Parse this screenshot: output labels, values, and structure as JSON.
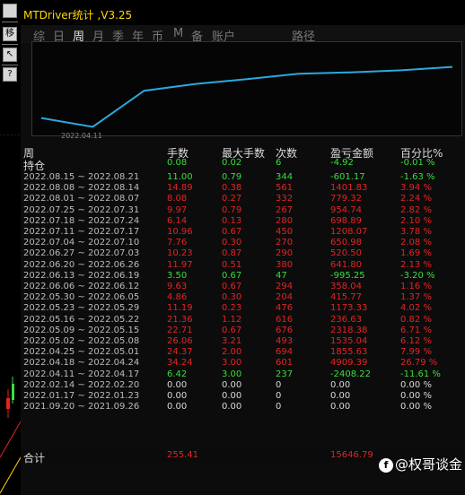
{
  "window": {
    "title": "MTDriver统计 ,V3.25"
  },
  "toolbar": {
    "buttons": [
      {
        "label": "",
        "icon": "arrow-icon"
      },
      {
        "label": "移",
        "icon": "move-icon"
      },
      {
        "label": "↖",
        "icon": "cursor-icon"
      },
      {
        "label": "",
        "icon": "line-icon"
      },
      {
        "label": "?",
        "icon": "help-icon"
      }
    ]
  },
  "tabs": [
    {
      "label": "综"
    },
    {
      "label": "日"
    },
    {
      "label": "周"
    },
    {
      "label": "月"
    },
    {
      "label": "季"
    },
    {
      "label": "年"
    },
    {
      "label": "币"
    },
    {
      "label": "M"
    },
    {
      "label": "备"
    },
    {
      "label": "账户"
    },
    {
      "label": "路径"
    }
  ],
  "equity_chart": {
    "date_label": "2022.04.11",
    "line_color": "#2aa9e0",
    "points": [
      [
        0,
        0.15
      ],
      [
        1,
        0.02
      ],
      [
        2,
        0.55
      ],
      [
        3,
        0.65
      ],
      [
        4,
        0.72
      ],
      [
        5,
        0.8
      ],
      [
        6,
        0.82
      ],
      [
        7,
        0.85
      ],
      [
        8,
        0.9
      ]
    ]
  },
  "table": {
    "headers": [
      "周",
      "手数",
      "最大手数",
      "次数",
      "盈亏金额",
      "百分比%"
    ],
    "holding": {
      "label": "持仓",
      "lots": "0.08",
      "max_lots": "0.02",
      "count": "6",
      "pnl": "-4.92",
      "pct": "-0.01 %"
    },
    "rows": [
      {
        "week": "2022.08.15 ~ 2022.08.21",
        "lots": "11.00",
        "max_lots": "0.79",
        "count": "344",
        "pnl": "-601.17",
        "pct": "-1.63 %",
        "color": "green"
      },
      {
        "week": "2022.08.08 ~ 2022.08.14",
        "lots": "14.89",
        "max_lots": "0.38",
        "count": "561",
        "pnl": "1401.83",
        "pct": "3.94 %",
        "color": "red"
      },
      {
        "week": "2022.08.01 ~ 2022.08.07",
        "lots": "8.08",
        "max_lots": "0.27",
        "count": "332",
        "pnl": "779.32",
        "pct": "2.24 %",
        "color": "red"
      },
      {
        "week": "2022.07.25 ~ 2022.07.31",
        "lots": "9.97",
        "max_lots": "0.79",
        "count": "267",
        "pnl": "954.74",
        "pct": "2.82 %",
        "color": "red"
      },
      {
        "week": "2022.07.18 ~ 2022.07.24",
        "lots": "6.14",
        "max_lots": "0.13",
        "count": "280",
        "pnl": "698.89",
        "pct": "2.10 %",
        "color": "red"
      },
      {
        "week": "2022.07.11 ~ 2022.07.17",
        "lots": "10.96",
        "max_lots": "0.67",
        "count": "450",
        "pnl": "1208.07",
        "pct": "3.78 %",
        "color": "red"
      },
      {
        "week": "2022.07.04 ~ 2022.07.10",
        "lots": "7.76",
        "max_lots": "0.30",
        "count": "270",
        "pnl": "650.98",
        "pct": "2.08 %",
        "color": "red"
      },
      {
        "week": "2022.06.27 ~ 2022.07.03",
        "lots": "10.23",
        "max_lots": "0.87",
        "count": "290",
        "pnl": "520.50",
        "pct": "1.69 %",
        "color": "red"
      },
      {
        "week": "2022.06.20 ~ 2022.06.26",
        "lots": "11.97",
        "max_lots": "0.51",
        "count": "380",
        "pnl": "641.80",
        "pct": "2.13 %",
        "color": "red"
      },
      {
        "week": "2022.06.13 ~ 2022.06.19",
        "lots": "3.50",
        "max_lots": "0.67",
        "count": "47",
        "pnl": "-995.25",
        "pct": "-3.20 %",
        "color": "green"
      },
      {
        "week": "2022.06.06 ~ 2022.06.12",
        "lots": "9.63",
        "max_lots": "0.67",
        "count": "294",
        "pnl": "358.04",
        "pct": "1.16 %",
        "color": "red"
      },
      {
        "week": "2022.05.30 ~ 2022.06.05",
        "lots": "4.86",
        "max_lots": "0.30",
        "count": "204",
        "pnl": "415.77",
        "pct": "1.37 %",
        "color": "red"
      },
      {
        "week": "2022.05.23 ~ 2022.05.29",
        "lots": "11.19",
        "max_lots": "0.23",
        "count": "476",
        "pnl": "1173.33",
        "pct": "4.02 %",
        "color": "red"
      },
      {
        "week": "2022.05.16 ~ 2022.05.22",
        "lots": "21.36",
        "max_lots": "1.12",
        "count": "616",
        "pnl": "236.63",
        "pct": "0.82 %",
        "color": "red"
      },
      {
        "week": "2022.05.09 ~ 2022.05.15",
        "lots": "22.71",
        "max_lots": "0.67",
        "count": "676",
        "pnl": "2318.38",
        "pct": "6.71 %",
        "color": "red"
      },
      {
        "week": "2022.05.02 ~ 2022.05.08",
        "lots": "26.06",
        "max_lots": "3.21",
        "count": "493",
        "pnl": "1535.04",
        "pct": "6.12 %",
        "color": "red"
      },
      {
        "week": "2022.04.25 ~ 2022.05.01",
        "lots": "24.37",
        "max_lots": "2.00",
        "count": "694",
        "pnl": "1855.63",
        "pct": "7.99 %",
        "color": "red"
      },
      {
        "week": "2022.04.18 ~ 2022.04.24",
        "lots": "34.24",
        "max_lots": "3.00",
        "count": "601",
        "pnl": "4909.39",
        "pct": "26.79 %",
        "color": "red"
      },
      {
        "week": "2022.04.11 ~ 2022.04.17",
        "lots": "6.42",
        "max_lots": "3.00",
        "count": "237",
        "pnl": "-2408.22",
        "pct": "-11.61 %",
        "color": "green"
      },
      {
        "week": "2022.02.14 ~ 2022.02.20",
        "lots": "0.00",
        "max_lots": "0.00",
        "count": "0",
        "pnl": "0.00",
        "pct": "0.00 %",
        "color": "white"
      },
      {
        "week": "2022.01.17 ~ 2022.01.23",
        "lots": "0.00",
        "max_lots": "0.00",
        "count": "0",
        "pnl": "0.00",
        "pct": "0.00 %",
        "color": "white"
      },
      {
        "week": "2021.09.20 ~ 2021.09.26",
        "lots": "0.00",
        "max_lots": "0.00",
        "count": "0",
        "pnl": "0.00",
        "pct": "0.00 %",
        "color": "white"
      }
    ],
    "total": {
      "label": "合计",
      "lots": "255.41",
      "pnl": "15646.79"
    }
  },
  "watermark": {
    "logo": "f",
    "text": "@权哥谈金"
  },
  "colors": {
    "profit": "#e52323",
    "loss": "#3ddc3d",
    "title": "#ffd700",
    "equity_line": "#2aa9e0"
  }
}
